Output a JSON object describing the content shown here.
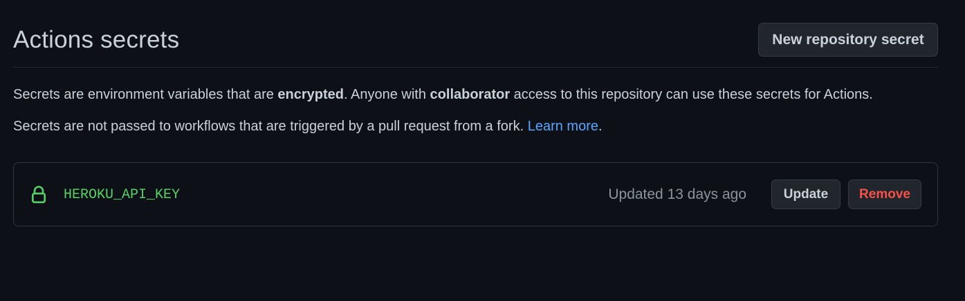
{
  "header": {
    "title": "Actions secrets",
    "new_secret_label": "New repository secret"
  },
  "description": {
    "line1": {
      "part1": "Secrets are environment variables that are ",
      "bold1": "encrypted",
      "part2": ". Anyone with ",
      "bold2": "collaborator",
      "part3": " access to this repository can use these secrets for Actions."
    },
    "line2": {
      "text": "Secrets are not passed to workflows that are triggered by a pull request from a fork. ",
      "link": "Learn more",
      "end": "."
    }
  },
  "secrets": [
    {
      "icon": "lock-icon",
      "name": "HEROKU_API_KEY",
      "updated": "Updated 13 days ago",
      "update_label": "Update",
      "remove_label": "Remove"
    }
  ],
  "colors": {
    "background": "#0d1117",
    "text": "#c9d1d9",
    "link": "#58a6ff",
    "secret_name": "#56d364",
    "danger": "#f85149",
    "muted": "#8b949e"
  }
}
